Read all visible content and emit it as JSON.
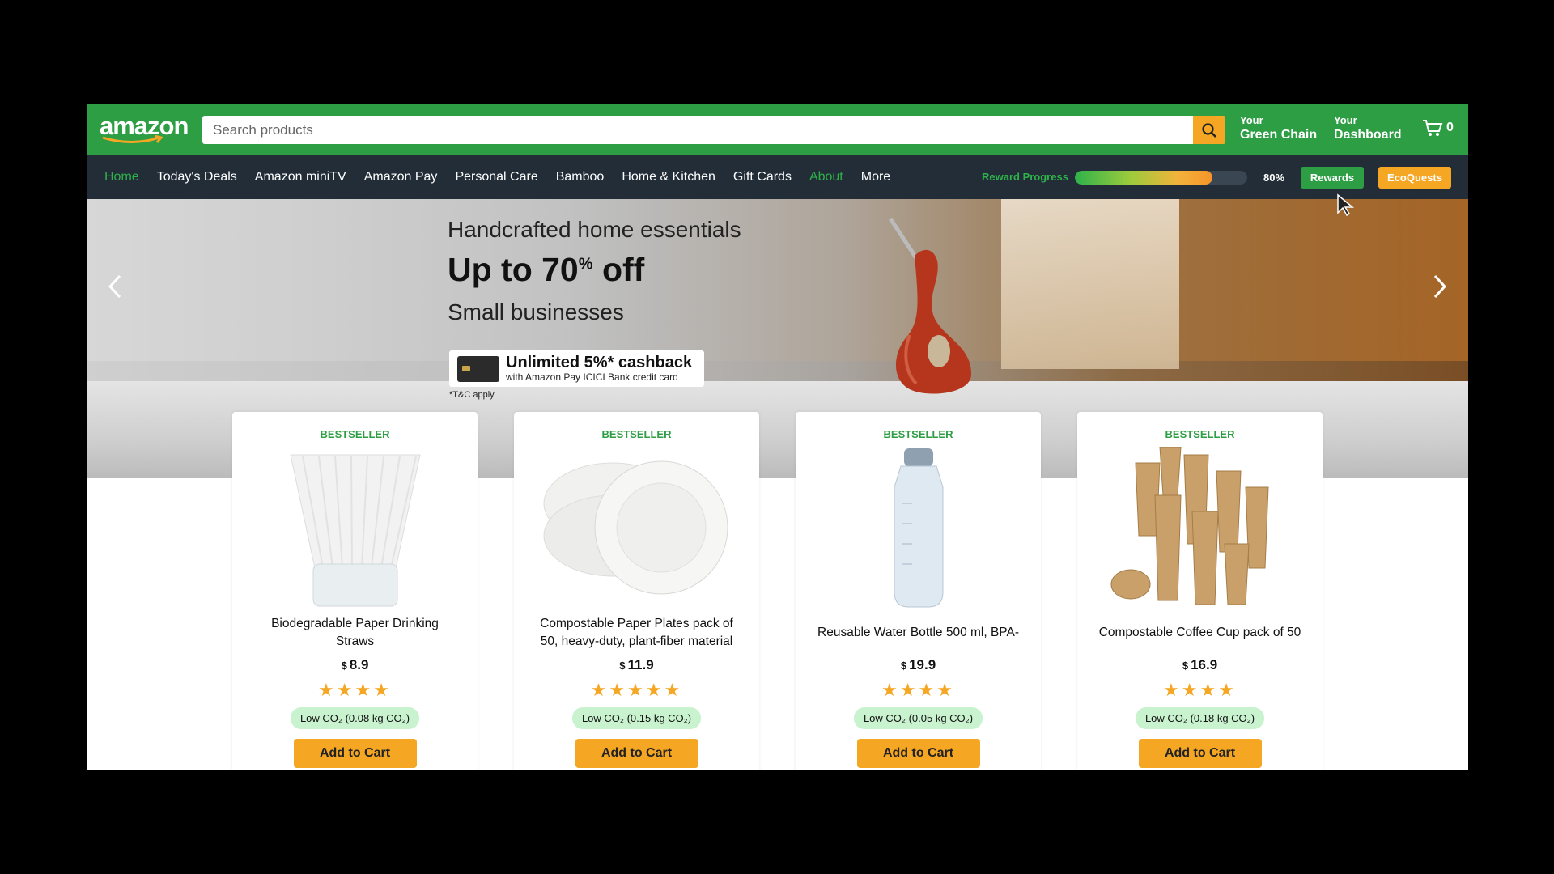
{
  "header": {
    "logo": "amazon",
    "search_placeholder": "Search products",
    "green_chain": {
      "small": "Your",
      "big": "Green Chain"
    },
    "dashboard": {
      "small": "Your",
      "big": "Dashboard"
    },
    "cart_count": "0"
  },
  "nav": {
    "items": [
      "Home",
      "Today's Deals",
      "Amazon miniTV",
      "Amazon Pay",
      "Personal Care",
      "Bamboo",
      "Home & Kitchen",
      "Gift Cards",
      "About",
      "More"
    ],
    "reward_label": "Reward Progress",
    "reward_progress": 0.8,
    "reward_pct": "80%",
    "rewards_button": "Rewards",
    "ecoquests_button": "EcoQuests"
  },
  "banner": {
    "line1": "Handcrafted home essentials",
    "line2": "Up to 70",
    "line2_sup": "%",
    "line2_suffix": " off",
    "line3": "Small businesses",
    "cashback_big": "Unlimited 5%* cashback",
    "cashback_small": "with Amazon Pay ICICI Bank credit card",
    "tnc": "*T&C apply"
  },
  "products": [
    {
      "badge": "BESTSELLER",
      "name": "Biodegradable Paper Drinking Straws",
      "currency": "$",
      "price": "8.9",
      "rating": 4,
      "co2": "Low CO₂ (0.08 kg CO₂)",
      "button": "Add to Cart"
    },
    {
      "badge": "BESTSELLER",
      "name": "Compostable Paper Plates pack of 50, heavy-duty, plant-fiber material",
      "currency": "$",
      "price": "11.9",
      "rating": 5,
      "co2": "Low CO₂ (0.15 kg CO₂)",
      "button": "Add to Cart"
    },
    {
      "badge": "BESTSELLER",
      "name": "Reusable Water Bottle 500 ml, BPA-",
      "currency": "$",
      "price": "19.9",
      "rating": 4,
      "co2": "Low CO₂ (0.05 kg CO₂)",
      "button": "Add to Cart"
    },
    {
      "badge": "BESTSELLER",
      "name": "Compostable Coffee Cup pack of 50",
      "currency": "$",
      "price": "16.9",
      "rating": 4,
      "co2": "Low CO₂ (0.18 kg CO₂)",
      "button": "Add to Cart"
    }
  ],
  "colors": {
    "brand_green": "#2e9e45",
    "nav_bg": "#222d38",
    "accent_orange": "#f5a623",
    "co2_badge": "#c9f2cf"
  }
}
